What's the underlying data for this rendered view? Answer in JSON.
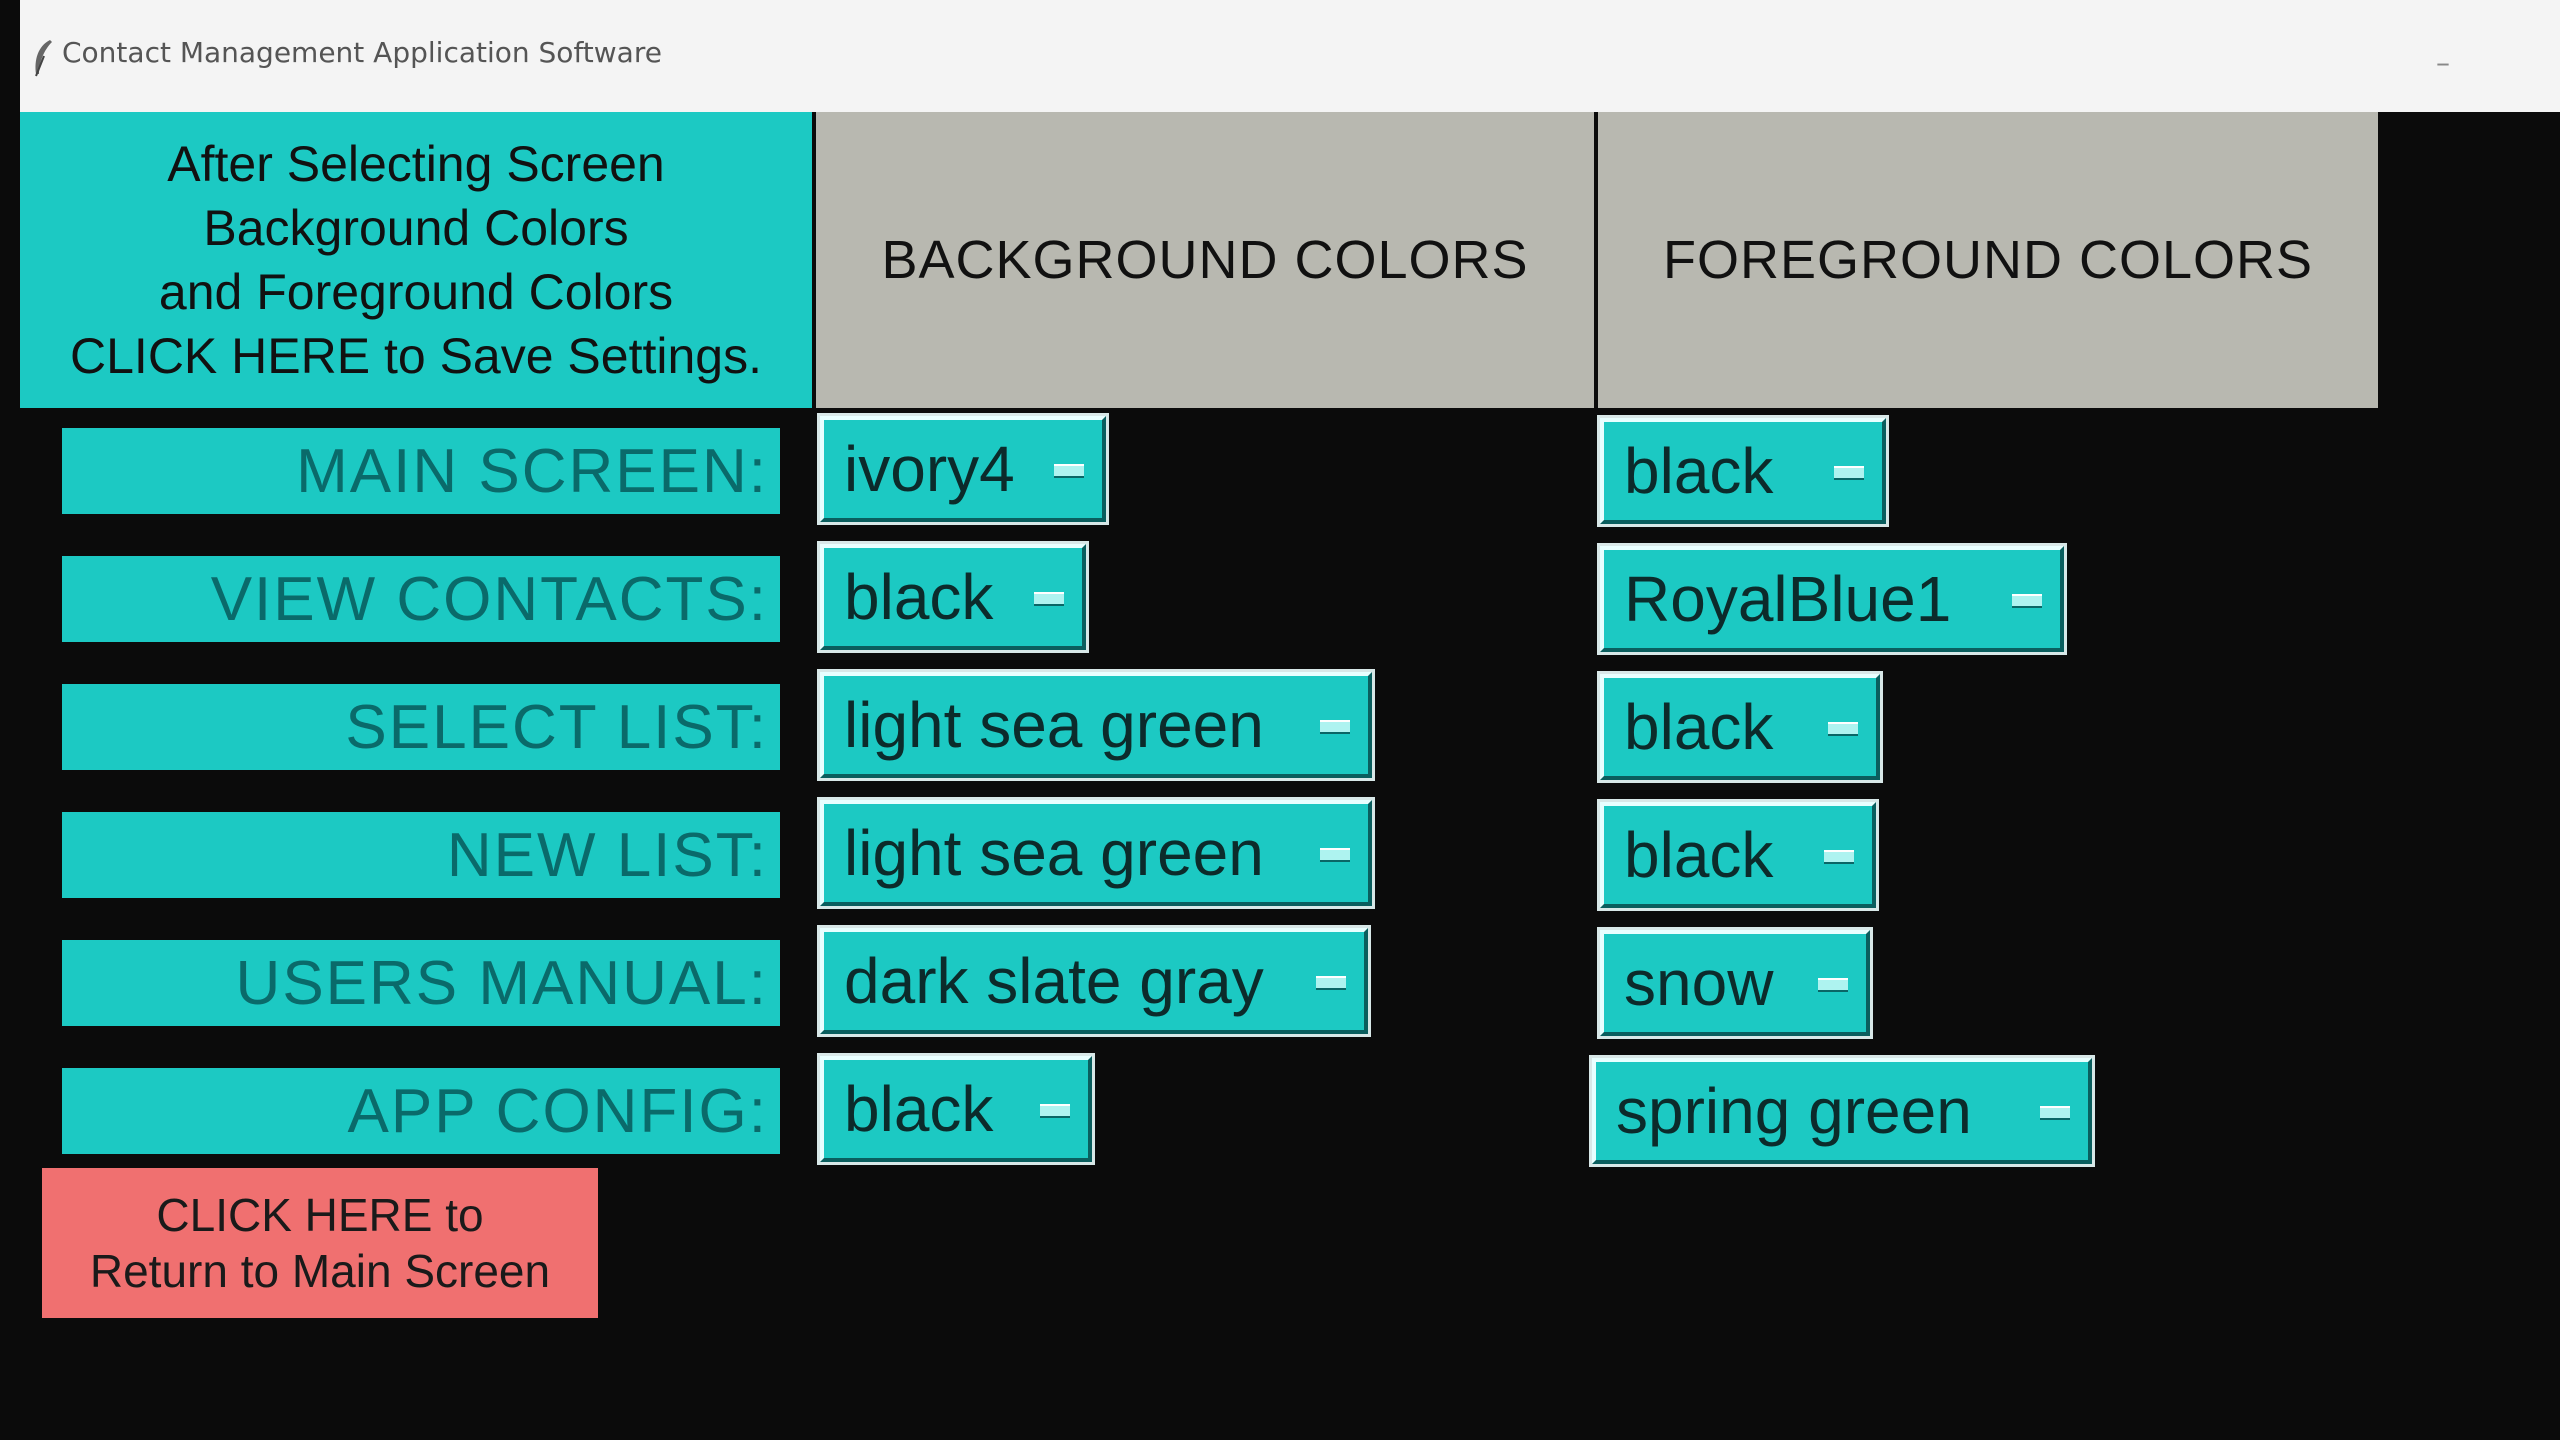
{
  "window": {
    "title": "Contact Management Application Software",
    "minimize": "–"
  },
  "save_settings": {
    "lines": [
      "After Selecting Screen",
      "Background Colors",
      "and Foreground Colors",
      "CLICK HERE to Save Settings."
    ]
  },
  "columns": {
    "background": "BACKGROUND COLORS",
    "foreground": "FOREGROUND COLORS"
  },
  "rows": [
    {
      "label": "MAIN SCREEN:",
      "background": "ivory4",
      "foreground": "black"
    },
    {
      "label": "VIEW CONTACTS:",
      "background": "black",
      "foreground": "RoyalBlue1"
    },
    {
      "label": "SELECT LIST:",
      "background": "light sea green",
      "foreground": "black"
    },
    {
      "label": "NEW LIST:",
      "background": "light sea green",
      "foreground": "black"
    },
    {
      "label": "USERS MANUAL:",
      "background": "dark slate gray",
      "foreground": "snow"
    },
    {
      "label": "APP CONFIG:",
      "background": "black",
      "foreground": "spring green"
    }
  ],
  "return_button": {
    "lines": [
      "CLICK HERE to",
      "Return to Main Screen"
    ]
  },
  "colors": {
    "accent": "#1cc9c3",
    "header_gray": "#b8b8b0",
    "return_button": "#f07070",
    "background": "#0b0b0b"
  }
}
